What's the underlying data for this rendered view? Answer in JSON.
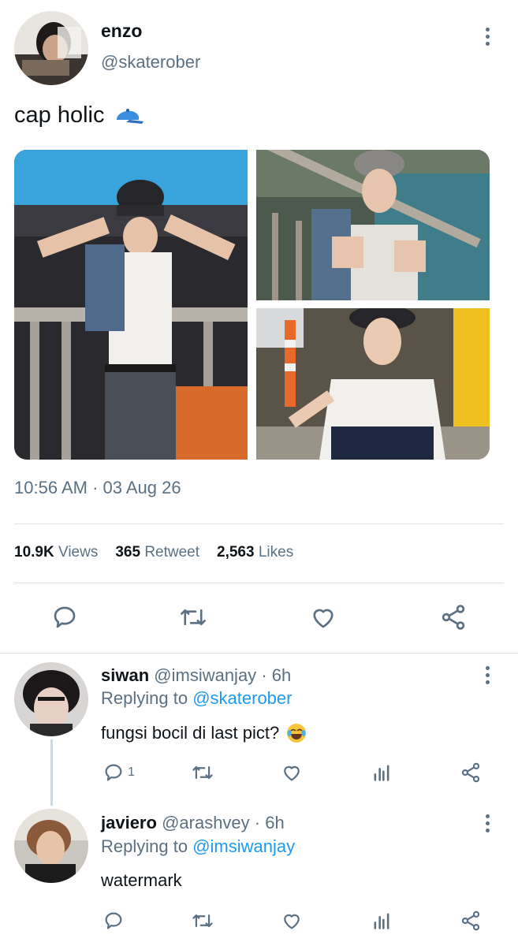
{
  "tweet": {
    "author_name": "enzo",
    "author_handle": "@skaterober",
    "text": "cap holic",
    "text_emoji": "🧢",
    "timestamp": "10:56 AM · 03 Aug 26",
    "stats": {
      "views_count": "10.9K",
      "views_label": "Views",
      "retweets_count": "365",
      "retweets_label": "Retweet",
      "likes_count": "2,563",
      "likes_label": "Likes"
    },
    "actions": [
      "reply-icon",
      "retweet-icon",
      "like-icon",
      "share-icon"
    ]
  },
  "replies": [
    {
      "name": "siwan",
      "handle": "@imsiwanjay",
      "time": "· 6h",
      "replying_prefix": "Replying to",
      "replying_to": "@skaterober",
      "text": "fungsi bocil di last pict?",
      "emoji": "😂",
      "reply_count": "1"
    },
    {
      "name": "javiero",
      "handle": "@arashvey",
      "time": "· 6h",
      "replying_prefix": "Replying to",
      "replying_to": "@imsiwanjay",
      "text": "watermark",
      "reply_count": ""
    }
  ],
  "colors": {
    "accent": "#1d9bf0",
    "muted": "#5b7083",
    "divider": "#dde3e8"
  }
}
